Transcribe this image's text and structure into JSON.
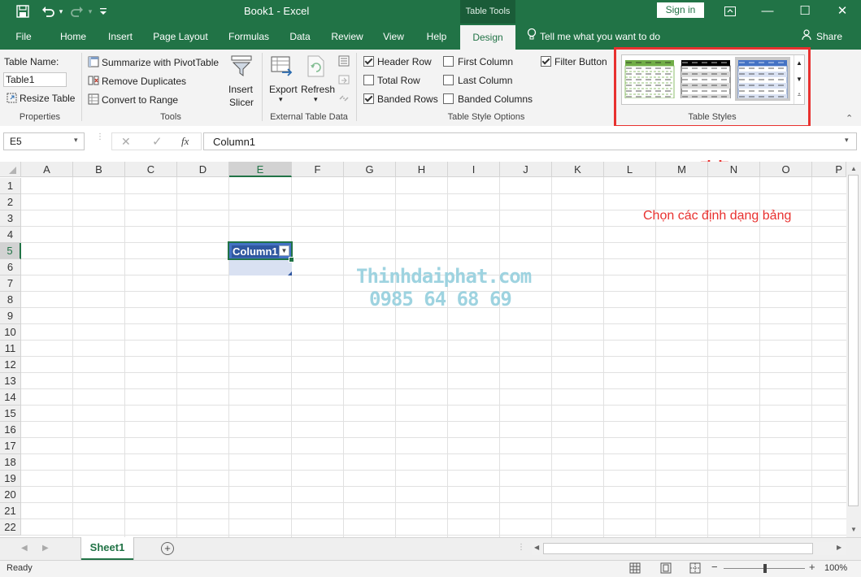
{
  "window": {
    "doc_title": "Book1  -  Excel",
    "context_tab": "Table Tools",
    "sign_in": "Sign in",
    "minimize": "—",
    "maximize": "☐",
    "close": "✕"
  },
  "tabs": [
    {
      "label": "File"
    },
    {
      "label": "Home"
    },
    {
      "label": "Insert"
    },
    {
      "label": "Page Layout"
    },
    {
      "label": "Formulas"
    },
    {
      "label": "Data"
    },
    {
      "label": "Review"
    },
    {
      "label": "View"
    },
    {
      "label": "Help"
    },
    {
      "label": "Design"
    }
  ],
  "tell_me": "Tell me what you want to do",
  "share": "Share",
  "ribbon": {
    "properties": {
      "label": "Properties",
      "table_name_label": "Table Name:",
      "table_name_value": "Table1",
      "resize": "Resize Table"
    },
    "tools": {
      "label": "Tools",
      "summarize": "Summarize with PivotTable",
      "remove_duplicates": "Remove Duplicates",
      "convert": "Convert to Range",
      "insert_slicer_1": "Insert",
      "insert_slicer_2": "Slicer"
    },
    "external": {
      "label": "External Table Data",
      "export": "Export",
      "refresh": "Refresh"
    },
    "style_options": {
      "label": "Table Style Options",
      "header_row": {
        "label": "Header Row",
        "checked": true
      },
      "total_row": {
        "label": "Total Row",
        "checked": false
      },
      "banded_rows": {
        "label": "Banded Rows",
        "checked": true
      },
      "first_column": {
        "label": "First Column",
        "checked": false
      },
      "last_column": {
        "label": "Last Column",
        "checked": false
      },
      "banded_columns": {
        "label": "Banded Columns",
        "checked": false
      },
      "filter_button": {
        "label": "Filter Button",
        "checked": true
      }
    },
    "table_styles": {
      "label": "Table Styles",
      "styles": [
        {
          "color": "#70ad47",
          "band": "#e2efda"
        },
        {
          "color": "#000000",
          "band": "#d9d9d9"
        },
        {
          "color": "#4472c4",
          "band": "#d9e1f2"
        }
      ]
    }
  },
  "formula_bar": {
    "name_box": "E5",
    "fx": "fx",
    "content": "Column1"
  },
  "grid": {
    "columns": [
      "A",
      "B",
      "C",
      "D",
      "E",
      "F",
      "G",
      "H",
      "I",
      "J",
      "K",
      "L",
      "M",
      "N",
      "O",
      "P"
    ],
    "rows": [
      "1",
      "2",
      "3",
      "4",
      "5",
      "6",
      "7",
      "8",
      "9",
      "10",
      "11",
      "12",
      "13",
      "14",
      "15",
      "16",
      "17",
      "18",
      "19",
      "20",
      "21",
      "22"
    ],
    "active_cell": "E5",
    "table_header": "Column1"
  },
  "annotation": {
    "text": "Chọn các định dạng bảng",
    "color": "#e8312f"
  },
  "watermark": {
    "line1": "Thinhdaiphat.com",
    "line2": "0985 64 68 69"
  },
  "sheets": [
    {
      "label": "Sheet1"
    }
  ],
  "status": {
    "ready": "Ready",
    "zoom": "100%"
  },
  "colors": {
    "excel_green": "#217346",
    "table_blue": "#4472c4"
  }
}
